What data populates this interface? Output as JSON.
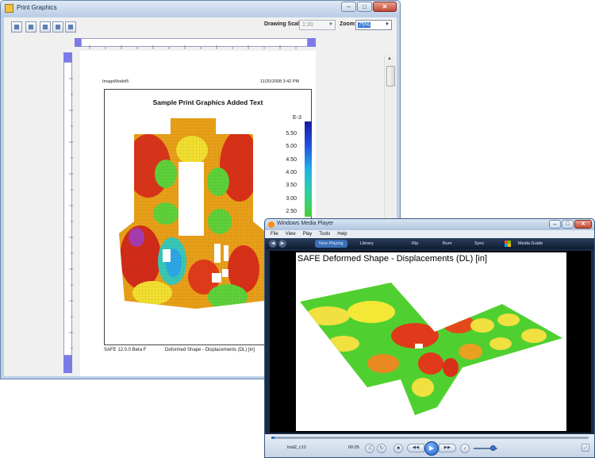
{
  "print_window": {
    "title": "Print Graphics",
    "caption_buttons": {
      "minimize": "–",
      "maximize": "□",
      "close": "✕"
    },
    "toolbar": {
      "drawing_scale_label": "Drawing Scale",
      "drawing_scale_value": "1:20",
      "zoom_label": "Zoom",
      "zoom_value": "75%"
    },
    "page": {
      "model_name": "ImageModel5",
      "date": "11/20/2008 3:42 PM",
      "title": "Sample Print Graphics Added Text",
      "footer_version": "SAFE 12.0.0 Beta F",
      "footer_caption": "Deformed Shape - Displacements (DL)  [in]",
      "colorbar": {
        "exponent": "E-3",
        "labels": [
          "5.50",
          "5.00",
          "4.50",
          "4.00",
          "3.50",
          "3.00",
          "2.50"
        ]
      }
    }
  },
  "media_player": {
    "title": "Windows Media Player",
    "menu": [
      "File",
      "View",
      "Play",
      "Tools",
      "Help"
    ],
    "nav_tabs": [
      "Now Playing",
      "Library",
      "Rip",
      "Burn",
      "Sync",
      "Media Guide"
    ],
    "video_caption": "SAFE Deformed Shape - Displacements (DL)  [in]",
    "track_name": "trial2_c12",
    "elapsed": "00:05",
    "progress_fraction": 0.01,
    "volume_fraction": 0.8
  },
  "colors": {
    "ruler_blue": "#7b7be8",
    "contour_red": "#e0281c",
    "contour_green": "#3fcf2c",
    "wmp_dark": "#1b2c45",
    "accent_blue": "#3b6fb5"
  }
}
